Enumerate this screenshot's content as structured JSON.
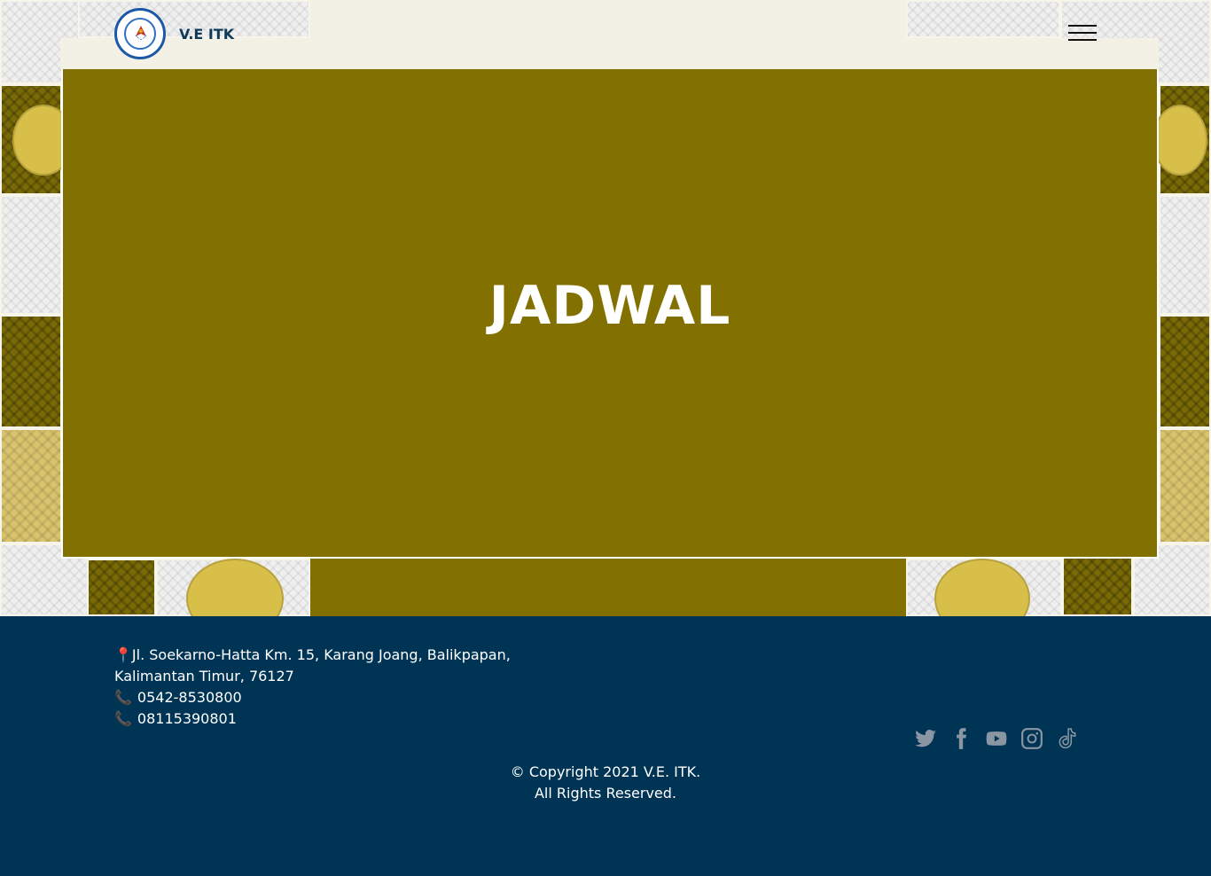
{
  "header": {
    "brand": "V.E ITK",
    "menu_icon": "hamburger-menu-icon",
    "logo_icon": "institution-seal-logo"
  },
  "hero": {
    "title": "JADWAL",
    "background_color": "#827000"
  },
  "footer": {
    "address_line_1": "Jl. Soekarno-Hatta Km. 15, Karang Joang, Balikpapan,",
    "address_line_2": "Kalimantan Timur, 76127",
    "phone_1": "0542-8530800",
    "phone_2": "08115390801",
    "copyright_line_1": "© Copyright 2021 V.E. ITK.",
    "copyright_line_2": "All Rights Reserved.",
    "background_color": "#003454",
    "social_icons": [
      "twitter-icon",
      "facebook-icon",
      "youtube-icon",
      "instagram-icon",
      "tiktok-icon"
    ]
  }
}
